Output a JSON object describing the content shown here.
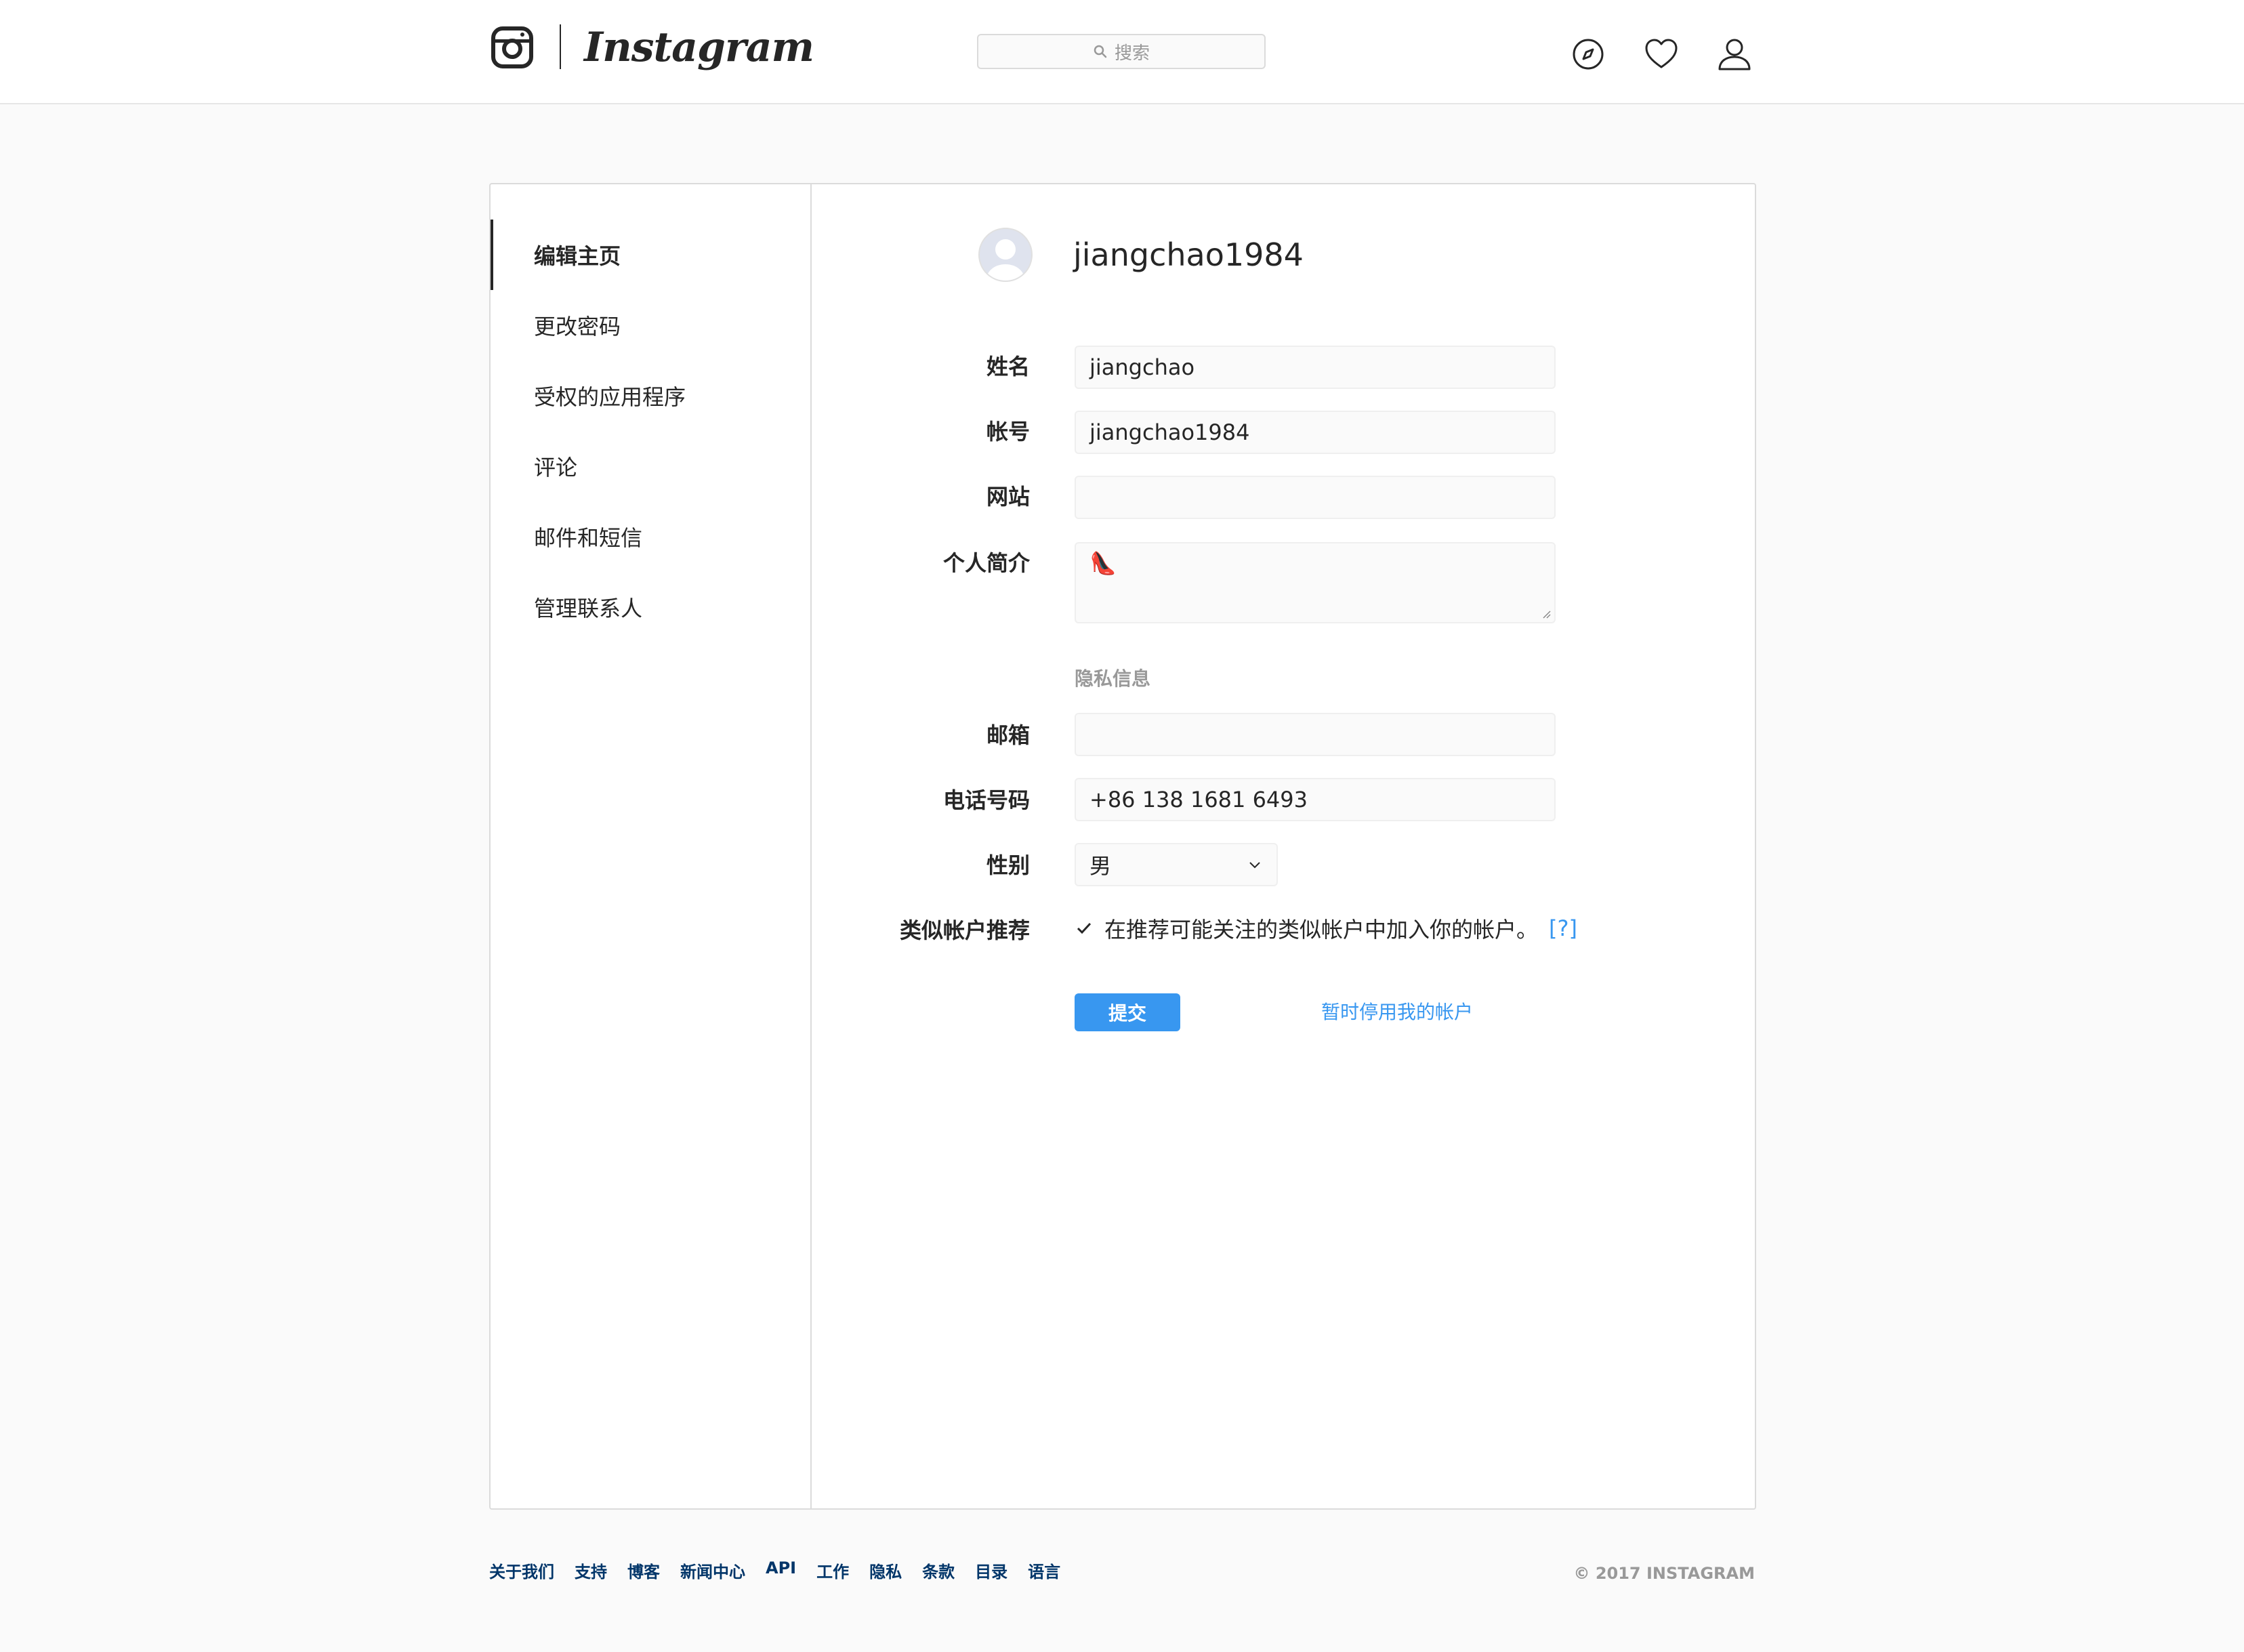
{
  "header": {
    "wordmark": "Instagram",
    "search_placeholder": "搜索"
  },
  "sidebar": {
    "items": [
      {
        "label": "编辑主页",
        "active": true
      },
      {
        "label": "更改密码"
      },
      {
        "label": "受权的应用程序"
      },
      {
        "label": "评论"
      },
      {
        "label": "邮件和短信"
      },
      {
        "label": "管理联系人"
      }
    ]
  },
  "profile": {
    "username": "jiangchao1984"
  },
  "form": {
    "name_label": "姓名",
    "name_value": "jiangchao",
    "username_label": "帐号",
    "username_value": "jiangchao1984",
    "website_label": "网站",
    "website_value": "",
    "bio_label": "个人简介",
    "bio_value": "👠",
    "private_section": "隐私信息",
    "email_label": "邮箱",
    "email_value": "",
    "phone_label": "电话号码",
    "phone_value": "+86 138 1681 6493",
    "gender_label": "性别",
    "gender_value": "男",
    "suggest_label": "类似帐户推荐",
    "suggest_text": "在推荐可能关注的类似帐户中加入你的帐户。",
    "suggest_checked": true,
    "help_link": "[?]",
    "submit_label": "提交",
    "disable_label": "暂时停用我的帐户"
  },
  "footer": {
    "links": [
      "关于我们",
      "支持",
      "博客",
      "新闻中心",
      "API",
      "工作",
      "隐私",
      "条款",
      "目录",
      "语言"
    ],
    "copyright": "© 2017 INSTAGRAM"
  },
  "colors": {
    "accent": "#3897f0",
    "footer_link": "#003569",
    "border": "#dbdbdb"
  }
}
